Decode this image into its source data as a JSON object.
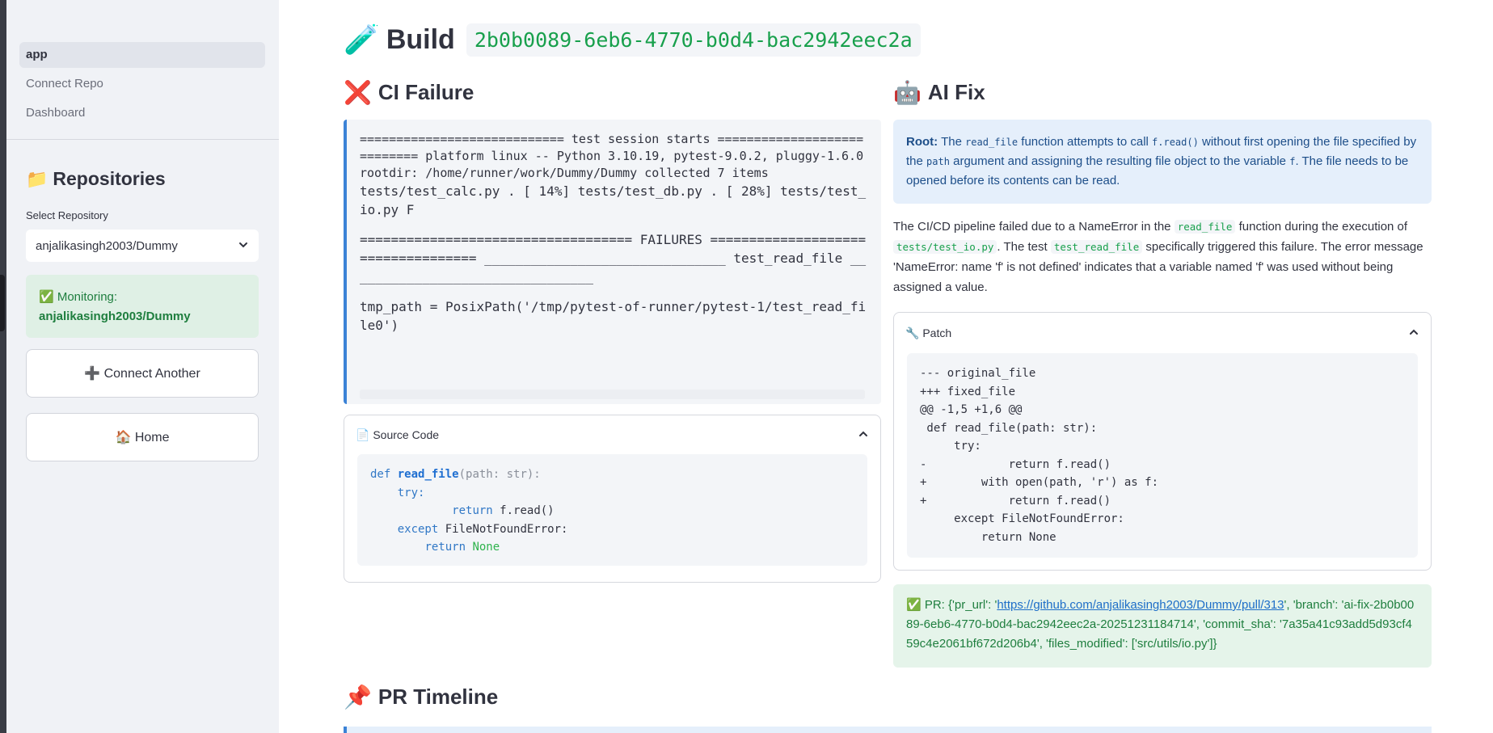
{
  "sidebar": {
    "nav": [
      "app",
      "Connect Repo",
      "Dashboard"
    ],
    "repositories_title": "Repositories",
    "repositories_icon": "folder-icon",
    "select_label": "Select Repository",
    "selected_repo": "anjalikasingh2003/Dummy",
    "monitoring_prefix": "✅ Monitoring:",
    "monitoring_repo": "anjalikasingh2003/Dummy",
    "connect_another": "➕ Connect Another",
    "home": "🏠 Home"
  },
  "build": {
    "icon": "test-tube-icon",
    "title": "Build",
    "id": "2b0b0089-6eb6-4770-b0d4-bac2942eec2a"
  },
  "ci_failure": {
    "title": "CI Failure",
    "icon": "cross-mark-icon",
    "log_lines": [
      "============================ test session starts ============================ platform linux -- Python 3.10.19, pytest-9.0.2, pluggy-1.6.0 rootdir: /home/runner/work/Dummy/Dummy collected 7 items",
      "tests/test_calc.py . [ 14%] tests/test_db.py . [ 28%] tests/test_io.py F",
      "=================================== FAILURES =================================== _______________________________ test_read_file ________________________________",
      "tmp_path = PosixPath('/tmp/pytest-of-runner/pytest-1/test_read_file0')"
    ]
  },
  "source_code": {
    "label": "📄 Source Code",
    "lines": [
      {
        "kw": "def",
        "fn": "read_file",
        "rest": "(path: str):"
      },
      {
        "kw": "try:"
      },
      {
        "kw": "return",
        "rest": "f.read()"
      },
      {
        "kw": "except",
        "rest": "FileNotFoundError:"
      },
      {
        "kw": "return",
        "val": "None"
      }
    ]
  },
  "ai_fix": {
    "title": "AI Fix",
    "icon": "robot-icon",
    "root_label": "Root:",
    "root_parts": [
      "The ",
      "read_file",
      " function attempts to call ",
      "f.read()",
      " without first opening the file specified by the ",
      "path",
      " argument and assigning the resulting file object to the variable ",
      "f",
      ". The file needs to be opened before its contents can be read."
    ],
    "desc_parts": [
      "The CI/CD pipeline failed due to a NameError in the ",
      "read_file",
      " function during the execution of ",
      "tests/test_io.py",
      ". The test ",
      "test_read_file",
      " specifically triggered this failure. The error message 'NameError: name 'f' is not defined' indicates that a variable named 'f' was used without being assigned a value."
    ]
  },
  "patch": {
    "label": "🔧 Patch",
    "lines": [
      "--- original_file",
      "+++ fixed_file",
      "@@ -1,5 +1,6 @@",
      " def read_file(path: str):",
      "     try:",
      "-            return f.read()",
      "+        with open(path, 'r') as f:",
      "+            return f.read()",
      "     except FileNotFoundError:",
      "         return None"
    ]
  },
  "pr": {
    "prefix": "✅ PR: {'pr_url': '",
    "url": "https://github.com/anjalikasingh2003/Dummy/pull/313",
    "suffix": "', 'branch': 'ai-fix-2b0b0089-6eb6-4770-b0d4-bac2942eec2a-20251231184714', 'commit_sha': '7a35a41c93add5d93cf459c4e2061bf672d206b4', 'files_modified': ['src/utils/io.py']}"
  },
  "timeline": {
    "title": "PR Timeline",
    "icon": "pushpin-icon"
  }
}
